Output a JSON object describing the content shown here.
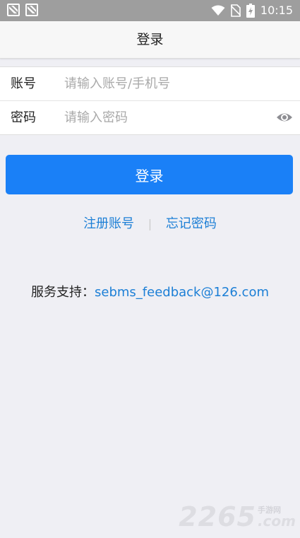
{
  "status_bar": {
    "time": "10:15",
    "icons": [
      "notification-icon",
      "notification-icon",
      "wifi-icon",
      "no-sim-icon",
      "battery-charging-icon"
    ]
  },
  "header": {
    "title": "登录"
  },
  "form": {
    "account": {
      "label": "账号",
      "value": "",
      "placeholder": "请输入账号/手机号"
    },
    "password": {
      "label": "密码",
      "value": "",
      "placeholder": "请输入密码",
      "toggle_icon": "eye-icon"
    }
  },
  "login_button": {
    "label": "登录"
  },
  "links": {
    "register": "注册账号",
    "separator": "|",
    "forgot_password": "忘记密码"
  },
  "support": {
    "label": "服务支持：",
    "email": "sebms_feedback@126.com"
  },
  "watermark": {
    "number": "2265",
    "site": "手游网",
    "com": ".com"
  },
  "colors": {
    "primary": "#1a80f7",
    "link": "#1c7fd6",
    "background": "#efeff4",
    "status_bar": "#9e9e9e"
  }
}
